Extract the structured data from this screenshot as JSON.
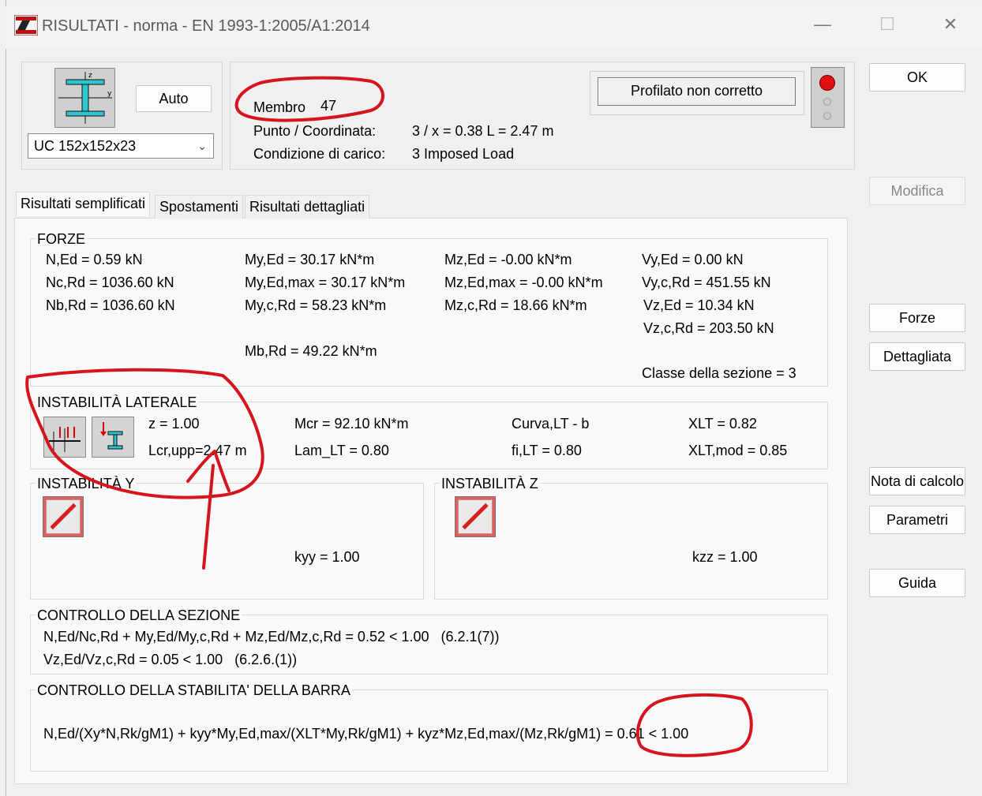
{
  "window": {
    "title": "RISULTATI - norma - EN 1993-1:2005/A1:2014",
    "minimize": "—",
    "maximize": "☐",
    "close": "✕"
  },
  "section": {
    "auto_label": "Auto",
    "profile": "UC 152x152x23"
  },
  "info": {
    "membro_label": "Membro",
    "membro_value": "47",
    "punto_label": "Punto / Coordinata:",
    "punto_value": "3 / x = 0.38 L = 2.47 m",
    "carico_label": "Condizione di carico:",
    "carico_value": "3 Imposed Load",
    "status_text": "Profilato non corretto"
  },
  "buttons": {
    "ok": "OK",
    "modifica": "Modifica",
    "forze": "Forze",
    "dettagliata": "Dettagliata",
    "nota": "Nota di calcolo",
    "parametri": "Parametri",
    "guida": "Guida"
  },
  "tabs": [
    "Risultati semplificati",
    "Spostamenti",
    "Risultati dettagliati"
  ],
  "forze": {
    "title": "FORZE",
    "col1": [
      "N,Ed = 0.59 kN",
      "Nc,Rd = 1036.60 kN",
      "Nb,Rd = 1036.60 kN"
    ],
    "col2": [
      "My,Ed = 30.17 kN*m",
      "My,Ed,max = 30.17 kN*m",
      "My,c,Rd = 58.23 kN*m"
    ],
    "col2_extra": "Mb,Rd = 49.22 kN*m",
    "col3": [
      "Mz,Ed = -0.00 kN*m",
      "Mz,Ed,max = -0.00 kN*m",
      "Mz,c,Rd = 18.66 kN*m"
    ],
    "col4": [
      "Vy,Ed = 0.00 kN",
      "Vy,c,Rd = 451.55 kN",
      "Vz,Ed = 10.34 kN",
      "Vz,c,Rd = 203.50 kN"
    ],
    "classe": "Classe della sezione = 3"
  },
  "instab_lat": {
    "title": "INSTABILITÀ LATERALE",
    "z": "z = 1.00",
    "lcr": "Lcr,upp=2.47 m",
    "mcr": "Mcr = 92.10 kN*m",
    "lam": "Lam_LT = 0.80",
    "curva": "Curva,LT - b",
    "fi": "fi,LT = 0.80",
    "xlt": "XLT = 0.82",
    "xltmod": "XLT,mod = 0.85"
  },
  "instab_y": {
    "title": "INSTABILITÀ Y",
    "k": "kyy = 1.00"
  },
  "instab_z": {
    "title": "INSTABILITÀ Z",
    "k": "kzz = 1.00"
  },
  "sezione": {
    "title": "CONTROLLO DELLA SEZIONE",
    "line1": "N,Ed/Nc,Rd + My,Ed/My,c,Rd + Mz,Ed/Mz,c,Rd = 0.52 < 1.00   (6.2.1(7))",
    "line2": "Vz,Ed/Vz,c,Rd = 0.05 < 1.00   (6.2.6.(1))"
  },
  "stabilita": {
    "title": "CONTROLLO DELLA STABILITA' DELLA BARRA",
    "line": "N,Ed/(Xy*N,Rk/gM1) + kyy*My,Ed,max/(XLT*My,Rk/gM1) + kyz*Mz,Ed,max/(Mz,Rk/gM1) = 0.61 < 1.00"
  },
  "colors": {
    "annotation": "#d6141c",
    "status_light": "#e01010"
  }
}
